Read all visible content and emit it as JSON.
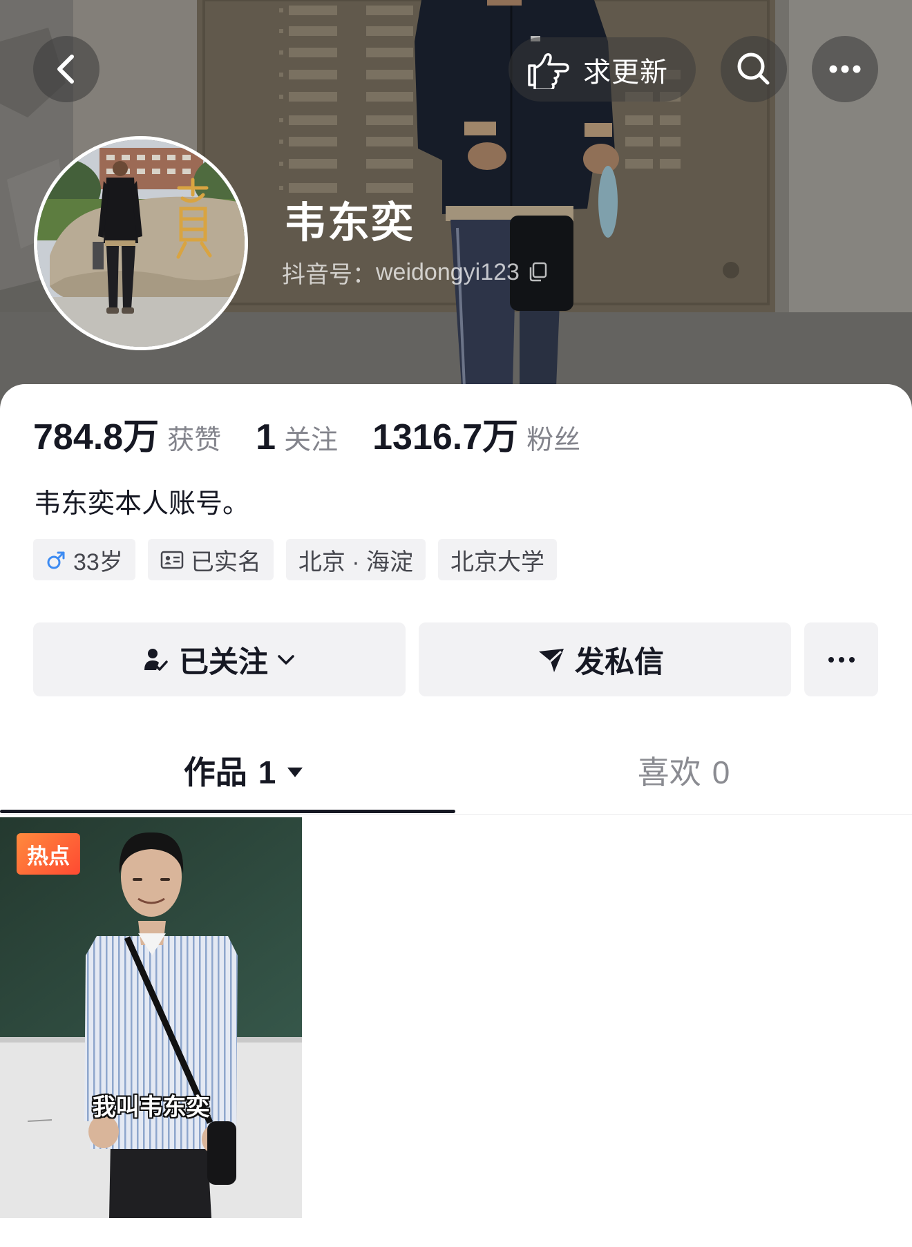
{
  "top_bar": {
    "back_icon": "chevron-left-icon",
    "request_update": {
      "icon": "hand-pointing-icon",
      "label": "求更新"
    },
    "search_icon": "search-icon",
    "more_icon": "more-horizontal-icon"
  },
  "profile": {
    "name": "韦东奕",
    "douyin_id_label": "抖音号：",
    "douyin_id": "weidongyi123",
    "copy_icon": "copy-icon",
    "stats": [
      {
        "value": "784.8万",
        "label": "获赞"
      },
      {
        "value": "1",
        "label": "关注"
      },
      {
        "value": "1316.7万",
        "label": "粉丝"
      }
    ],
    "bio": "韦东奕本人账号。",
    "tags": [
      {
        "icon": "male-icon",
        "text": "33岁"
      },
      {
        "icon": "id-card-icon",
        "text": "已实名"
      },
      {
        "text": "北京 · 海淀"
      },
      {
        "text": "北京大学"
      }
    ]
  },
  "actions": {
    "follow": {
      "icon": "person-check-icon",
      "label": "已关注",
      "dropdown_icon": "chevron-down-icon"
    },
    "message": {
      "icon": "send-icon",
      "label": "发私信"
    },
    "more_icon": "more-horizontal-icon"
  },
  "tabs": [
    {
      "label": "作品",
      "count": "1",
      "selected": true,
      "dropdown_icon": "triangle-down-icon"
    },
    {
      "label": "喜欢",
      "count": "0",
      "selected": false
    }
  ],
  "videos": [
    {
      "badge": "热点",
      "caption": "我叫韦东奕"
    }
  ],
  "colors": {
    "text_primary": "#161823",
    "text_secondary": "#83848c",
    "chip_background": "#f2f2f4",
    "hot_badge": "#fe4a32",
    "male_icon": "#3d8bf2"
  }
}
